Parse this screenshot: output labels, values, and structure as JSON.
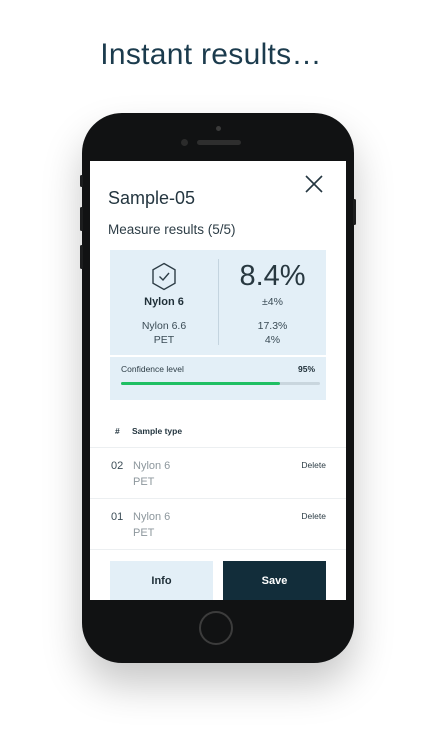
{
  "headline": "Instant results…",
  "sample": {
    "title": "Sample-05",
    "measure_title": "Measure results (5/5)"
  },
  "results": {
    "primary_material": "Nylon 6",
    "alternatives": [
      "Nylon 6.6",
      "PET"
    ],
    "primary_percent": "8.4%",
    "tolerance": "±4%",
    "alternative_percents": [
      "17.3%",
      "4%"
    ]
  },
  "confidence": {
    "label": "Confidence level",
    "value_text": "95%",
    "fraction": 0.8,
    "color": "#1fbf63"
  },
  "table": {
    "headers": {
      "number": "#",
      "type": "Sample type"
    },
    "rows": [
      {
        "number": "02",
        "line1": "Nylon 6",
        "line2": "PET",
        "action": "Delete"
      },
      {
        "number": "01",
        "line1": "Nylon 6",
        "line2": "PET",
        "action": "Delete"
      }
    ]
  },
  "buttons": {
    "info": "Info",
    "save": "Save"
  },
  "colors": {
    "accent_dark": "#122d3a",
    "card_bg": "#e3eff7"
  },
  "icons": {
    "close": "close-icon",
    "material": "hexagon-check-icon"
  }
}
